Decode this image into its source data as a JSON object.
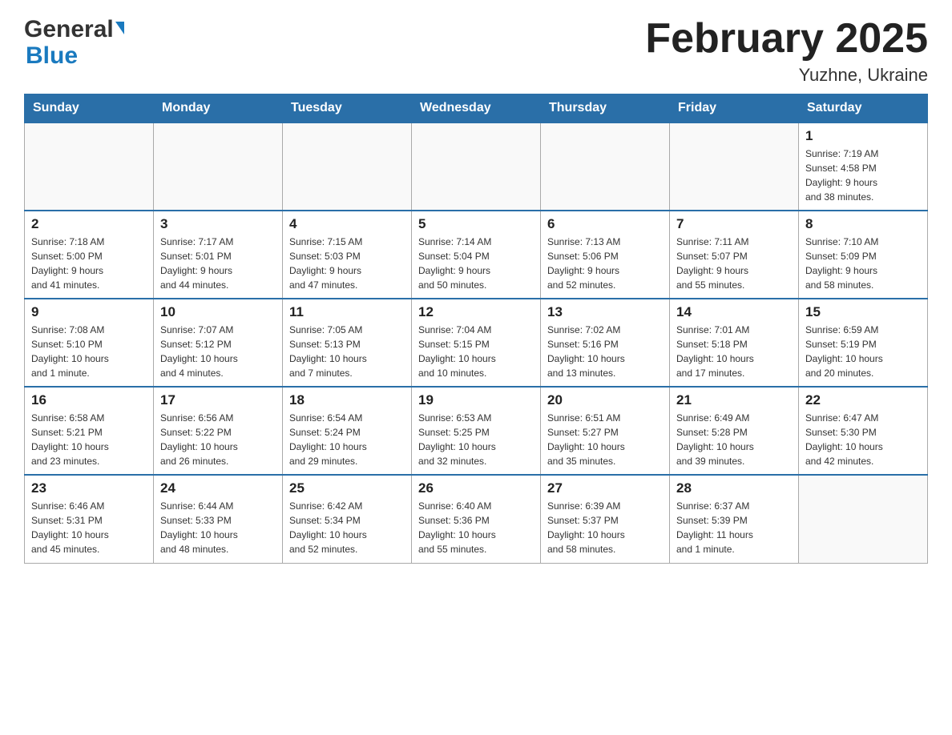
{
  "header": {
    "logo_general": "General",
    "logo_blue": "Blue",
    "title": "February 2025",
    "subtitle": "Yuzhne, Ukraine"
  },
  "days_of_week": [
    "Sunday",
    "Monday",
    "Tuesday",
    "Wednesday",
    "Thursday",
    "Friday",
    "Saturday"
  ],
  "weeks": [
    [
      {
        "day": "",
        "info": ""
      },
      {
        "day": "",
        "info": ""
      },
      {
        "day": "",
        "info": ""
      },
      {
        "day": "",
        "info": ""
      },
      {
        "day": "",
        "info": ""
      },
      {
        "day": "",
        "info": ""
      },
      {
        "day": "1",
        "info": "Sunrise: 7:19 AM\nSunset: 4:58 PM\nDaylight: 9 hours\nand 38 minutes."
      }
    ],
    [
      {
        "day": "2",
        "info": "Sunrise: 7:18 AM\nSunset: 5:00 PM\nDaylight: 9 hours\nand 41 minutes."
      },
      {
        "day": "3",
        "info": "Sunrise: 7:17 AM\nSunset: 5:01 PM\nDaylight: 9 hours\nand 44 minutes."
      },
      {
        "day": "4",
        "info": "Sunrise: 7:15 AM\nSunset: 5:03 PM\nDaylight: 9 hours\nand 47 minutes."
      },
      {
        "day": "5",
        "info": "Sunrise: 7:14 AM\nSunset: 5:04 PM\nDaylight: 9 hours\nand 50 minutes."
      },
      {
        "day": "6",
        "info": "Sunrise: 7:13 AM\nSunset: 5:06 PM\nDaylight: 9 hours\nand 52 minutes."
      },
      {
        "day": "7",
        "info": "Sunrise: 7:11 AM\nSunset: 5:07 PM\nDaylight: 9 hours\nand 55 minutes."
      },
      {
        "day": "8",
        "info": "Sunrise: 7:10 AM\nSunset: 5:09 PM\nDaylight: 9 hours\nand 58 minutes."
      }
    ],
    [
      {
        "day": "9",
        "info": "Sunrise: 7:08 AM\nSunset: 5:10 PM\nDaylight: 10 hours\nand 1 minute."
      },
      {
        "day": "10",
        "info": "Sunrise: 7:07 AM\nSunset: 5:12 PM\nDaylight: 10 hours\nand 4 minutes."
      },
      {
        "day": "11",
        "info": "Sunrise: 7:05 AM\nSunset: 5:13 PM\nDaylight: 10 hours\nand 7 minutes."
      },
      {
        "day": "12",
        "info": "Sunrise: 7:04 AM\nSunset: 5:15 PM\nDaylight: 10 hours\nand 10 minutes."
      },
      {
        "day": "13",
        "info": "Sunrise: 7:02 AM\nSunset: 5:16 PM\nDaylight: 10 hours\nand 13 minutes."
      },
      {
        "day": "14",
        "info": "Sunrise: 7:01 AM\nSunset: 5:18 PM\nDaylight: 10 hours\nand 17 minutes."
      },
      {
        "day": "15",
        "info": "Sunrise: 6:59 AM\nSunset: 5:19 PM\nDaylight: 10 hours\nand 20 minutes."
      }
    ],
    [
      {
        "day": "16",
        "info": "Sunrise: 6:58 AM\nSunset: 5:21 PM\nDaylight: 10 hours\nand 23 minutes."
      },
      {
        "day": "17",
        "info": "Sunrise: 6:56 AM\nSunset: 5:22 PM\nDaylight: 10 hours\nand 26 minutes."
      },
      {
        "day": "18",
        "info": "Sunrise: 6:54 AM\nSunset: 5:24 PM\nDaylight: 10 hours\nand 29 minutes."
      },
      {
        "day": "19",
        "info": "Sunrise: 6:53 AM\nSunset: 5:25 PM\nDaylight: 10 hours\nand 32 minutes."
      },
      {
        "day": "20",
        "info": "Sunrise: 6:51 AM\nSunset: 5:27 PM\nDaylight: 10 hours\nand 35 minutes."
      },
      {
        "day": "21",
        "info": "Sunrise: 6:49 AM\nSunset: 5:28 PM\nDaylight: 10 hours\nand 39 minutes."
      },
      {
        "day": "22",
        "info": "Sunrise: 6:47 AM\nSunset: 5:30 PM\nDaylight: 10 hours\nand 42 minutes."
      }
    ],
    [
      {
        "day": "23",
        "info": "Sunrise: 6:46 AM\nSunset: 5:31 PM\nDaylight: 10 hours\nand 45 minutes."
      },
      {
        "day": "24",
        "info": "Sunrise: 6:44 AM\nSunset: 5:33 PM\nDaylight: 10 hours\nand 48 minutes."
      },
      {
        "day": "25",
        "info": "Sunrise: 6:42 AM\nSunset: 5:34 PM\nDaylight: 10 hours\nand 52 minutes."
      },
      {
        "day": "26",
        "info": "Sunrise: 6:40 AM\nSunset: 5:36 PM\nDaylight: 10 hours\nand 55 minutes."
      },
      {
        "day": "27",
        "info": "Sunrise: 6:39 AM\nSunset: 5:37 PM\nDaylight: 10 hours\nand 58 minutes."
      },
      {
        "day": "28",
        "info": "Sunrise: 6:37 AM\nSunset: 5:39 PM\nDaylight: 11 hours\nand 1 minute."
      },
      {
        "day": "",
        "info": ""
      }
    ]
  ]
}
